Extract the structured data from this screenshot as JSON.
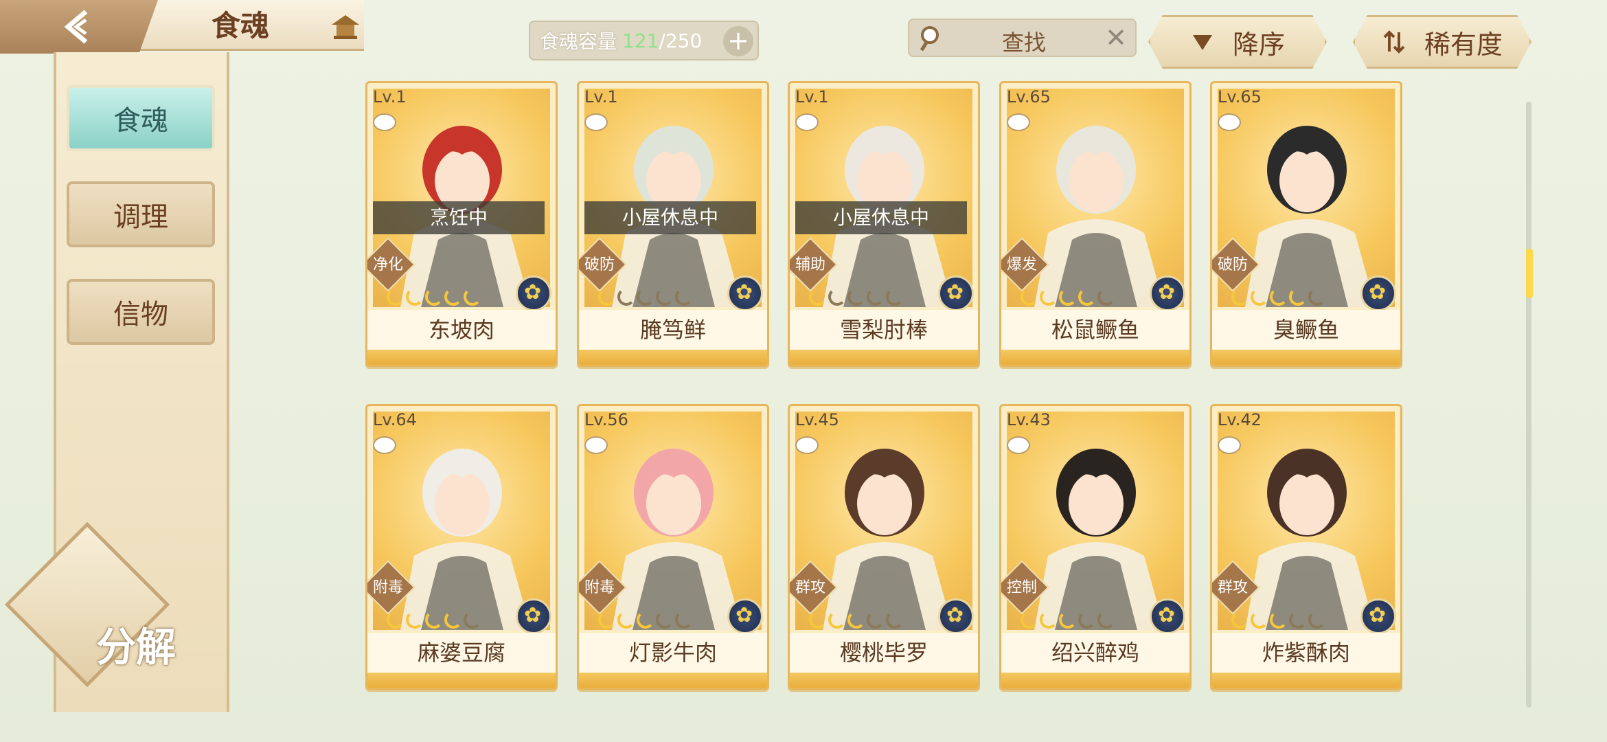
{
  "header": {
    "title": "食魂",
    "back_icon": "back-arrow-icon",
    "home_icon": "pavilion-icon",
    "capacity": {
      "label": "食魂容量",
      "current": "121",
      "max": "/250"
    },
    "search": {
      "placeholder": "查找"
    },
    "sort_order": "降序",
    "sort_key": "稀有度"
  },
  "sidebar": {
    "tabs": [
      {
        "label": "食魂",
        "active": true
      },
      {
        "label": "调理",
        "active": false
      },
      {
        "label": "信物",
        "active": false
      }
    ],
    "decompose_label": "分解"
  },
  "cards": [
    {
      "level": "Lv.1",
      "name": "东坡肉",
      "status": "烹饪中",
      "role": "净化",
      "stars": 5,
      "filled": 5,
      "hair": "#c8352a"
    },
    {
      "level": "Lv.1",
      "name": "腌笃鲜",
      "status": "小屋休息中",
      "role": "破防",
      "stars": 5,
      "filled": 1,
      "hair": "#dfe4d8"
    },
    {
      "level": "Lv.1",
      "name": "雪梨肘棒",
      "status": "小屋休息中",
      "role": "辅助",
      "stars": 5,
      "filled": 1,
      "hair": "#ece8e0"
    },
    {
      "level": "Lv.65",
      "name": "松鼠鳜鱼",
      "status": "",
      "role": "爆发",
      "stars": 5,
      "filled": 4,
      "hair": "#e9e6dc"
    },
    {
      "level": "Lv.65",
      "name": "臭鳜鱼",
      "status": "",
      "role": "破防",
      "stars": 5,
      "filled": 4,
      "hair": "#2b2b2b"
    },
    {
      "level": "Lv.64",
      "name": "麻婆豆腐",
      "status": "",
      "role": "附毒",
      "stars": 5,
      "filled": 4,
      "hair": "#f0ece6"
    },
    {
      "level": "Lv.56",
      "name": "灯影牛肉",
      "status": "",
      "role": "附毒",
      "stars": 5,
      "filled": 3,
      "hair": "#f2a6a8"
    },
    {
      "level": "Lv.45",
      "name": "樱桃毕罗",
      "status": "",
      "role": "群攻",
      "stars": 5,
      "filled": 3,
      "hair": "#5b3b2a"
    },
    {
      "level": "Lv.43",
      "name": "绍兴醉鸡",
      "status": "",
      "role": "控制",
      "stars": 5,
      "filled": 3,
      "hair": "#2a2420"
    },
    {
      "level": "Lv.42",
      "name": "炸紫酥肉",
      "status": "",
      "role": "群攻",
      "stars": 5,
      "filled": 3,
      "hair": "#4a3326"
    }
  ]
}
